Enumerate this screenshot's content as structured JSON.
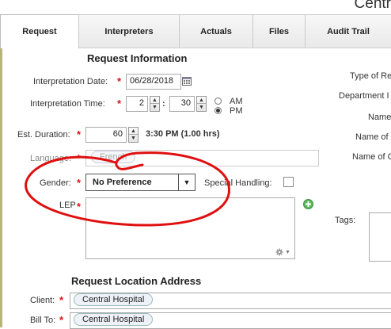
{
  "app": {
    "title": "Centr"
  },
  "tabs": [
    {
      "label": "Request"
    },
    {
      "label": "Interpreters"
    },
    {
      "label": "Actuals"
    },
    {
      "label": "Files"
    },
    {
      "label": "Audit Trail"
    }
  ],
  "request_info": {
    "title": "Request Information",
    "interpretation_date": {
      "label": "Interpretation Date:",
      "value": "06/28/2018"
    },
    "interpretation_time": {
      "label": "Interpretation Time:",
      "hour": "2",
      "minute": "30",
      "am_label": "AM",
      "pm_label": "PM",
      "selected": "PM"
    },
    "est_duration": {
      "label": "Est. Duration:",
      "value": "60",
      "result": "3:30 PM (1.00 hrs)"
    },
    "language": {
      "label": "Language:",
      "value": "French"
    },
    "gender": {
      "label": "Gender:",
      "value": "No Preference"
    },
    "special_handling": {
      "label": "Special Handling:"
    },
    "lep": {
      "label": "LEP"
    },
    "tags": {
      "label": "Tags:"
    }
  },
  "right_labels": [
    "Type of Re",
    "Department I",
    "Name",
    "Name of",
    "Name of C"
  ],
  "location": {
    "title": "Request Location Address",
    "client": {
      "label": "Client:",
      "value": "Central Hospital"
    },
    "bill_to": {
      "label": "Bill To:",
      "value": "Central Hospital"
    }
  },
  "colors": {
    "required": "#d11111",
    "annotation": "#e01010",
    "leftbar": "#b9b57a"
  },
  "icons": [
    "calendar-icon",
    "add-icon",
    "gear-icon"
  ]
}
